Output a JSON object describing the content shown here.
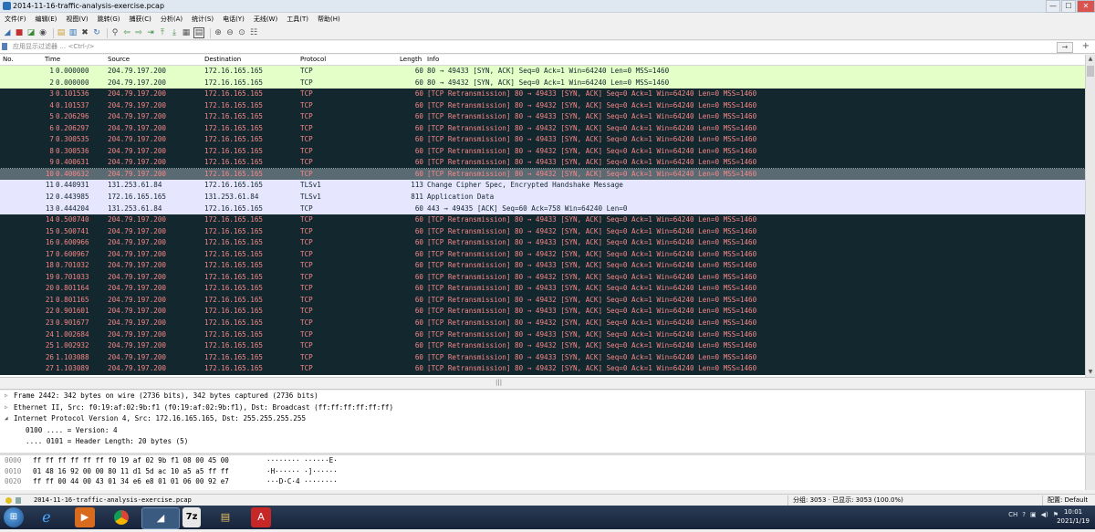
{
  "window": {
    "title": "2014-11-16-traffic-analysis-exercise.pcap",
    "buttons": {
      "minimize": "—",
      "maximize": "☐",
      "close": "✕"
    }
  },
  "menu": [
    "文件(F)",
    "编辑(E)",
    "视图(V)",
    "跳转(G)",
    "捕获(C)",
    "分析(A)",
    "统计(S)",
    "电话(Y)",
    "无线(W)",
    "工具(T)",
    "帮助(H)"
  ],
  "toolbar_icons": [
    "fin-icon",
    "stop-icon",
    "restart-icon",
    "options-icon",
    "open-icon",
    "save-icon",
    "close-file-icon",
    "reload-icon",
    "find-icon",
    "back-icon",
    "forward-icon",
    "goto-icon",
    "first-icon",
    "last-icon",
    "autoscroll-icon",
    "colorize-icon",
    "zoom-in-icon",
    "zoom-out-icon",
    "zoom-reset-icon",
    "resize-columns-icon"
  ],
  "filter": {
    "placeholder": "应用显示过滤器 … <Ctrl-/>",
    "arrow": "→",
    "plus": "+"
  },
  "columns": {
    "no": "No.",
    "time": "Time",
    "source": "Source",
    "destination": "Destination",
    "protocol": "Protocol",
    "length": "Length",
    "info": "Info"
  },
  "colors": {
    "syn_ack_bg": "#e4ffc7",
    "syn_ack_fg": "#12272e",
    "retrans_bg": "#12272e",
    "retrans_fg": "#f78787",
    "selected_bg": "#5a6a72",
    "tls_bg": "#e7e6ff",
    "tls_fg": "#12272e"
  },
  "packets": [
    {
      "no": "1",
      "time": "0.000000",
      "src": "204.79.197.200",
      "dst": "172.16.165.165",
      "proto": "TCP",
      "len": "60",
      "info": "80 → 49433 [SYN, ACK] Seq=0 Ack=1 Win=64240 Len=0 MSS=1460",
      "style": "syn"
    },
    {
      "no": "2",
      "time": "0.000000",
      "src": "204.79.197.200",
      "dst": "172.16.165.165",
      "proto": "TCP",
      "len": "60",
      "info": "80 → 49432 [SYN, ACK] Seq=0 Ack=1 Win=64240 Len=0 MSS=1460",
      "style": "syn"
    },
    {
      "no": "3",
      "time": "0.101536",
      "src": "204.79.197.200",
      "dst": "172.16.165.165",
      "proto": "TCP",
      "len": "60",
      "info": "[TCP Retransmission] 80 → 49433 [SYN, ACK] Seq=0 Ack=1 Win=64240 Len=0 MSS=1460",
      "style": "retrans"
    },
    {
      "no": "4",
      "time": "0.101537",
      "src": "204.79.197.200",
      "dst": "172.16.165.165",
      "proto": "TCP",
      "len": "60",
      "info": "[TCP Retransmission] 80 → 49432 [SYN, ACK] Seq=0 Ack=1 Win=64240 Len=0 MSS=1460",
      "style": "retrans"
    },
    {
      "no": "5",
      "time": "0.206296",
      "src": "204.79.197.200",
      "dst": "172.16.165.165",
      "proto": "TCP",
      "len": "60",
      "info": "[TCP Retransmission] 80 → 49433 [SYN, ACK] Seq=0 Ack=1 Win=64240 Len=0 MSS=1460",
      "style": "retrans"
    },
    {
      "no": "6",
      "time": "0.206297",
      "src": "204.79.197.200",
      "dst": "172.16.165.165",
      "proto": "TCP",
      "len": "60",
      "info": "[TCP Retransmission] 80 → 49432 [SYN, ACK] Seq=0 Ack=1 Win=64240 Len=0 MSS=1460",
      "style": "retrans"
    },
    {
      "no": "7",
      "time": "0.300535",
      "src": "204.79.197.200",
      "dst": "172.16.165.165",
      "proto": "TCP",
      "len": "60",
      "info": "[TCP Retransmission] 80 → 49433 [SYN, ACK] Seq=0 Ack=1 Win=64240 Len=0 MSS=1460",
      "style": "retrans"
    },
    {
      "no": "8",
      "time": "0.300536",
      "src": "204.79.197.200",
      "dst": "172.16.165.165",
      "proto": "TCP",
      "len": "60",
      "info": "[TCP Retransmission] 80 → 49432 [SYN, ACK] Seq=0 Ack=1 Win=64240 Len=0 MSS=1460",
      "style": "retrans"
    },
    {
      "no": "9",
      "time": "0.400631",
      "src": "204.79.197.200",
      "dst": "172.16.165.165",
      "proto": "TCP",
      "len": "60",
      "info": "[TCP Retransmission] 80 → 49433 [SYN, ACK] Seq=0 Ack=1 Win=64240 Len=0 MSS=1460",
      "style": "retrans"
    },
    {
      "no": "10",
      "time": "0.400632",
      "src": "204.79.197.200",
      "dst": "172.16.165.165",
      "proto": "TCP",
      "len": "60",
      "info": "[TCP Retransmission] 80 → 49432 [SYN, ACK] Seq=0 Ack=1 Win=64240 Len=0 MSS=1460",
      "style": "selected"
    },
    {
      "no": "11",
      "time": "0.440931",
      "src": "131.253.61.84",
      "dst": "172.16.165.165",
      "proto": "TLSv1",
      "len": "113",
      "info": "Change Cipher Spec, Encrypted Handshake Message",
      "style": "tls"
    },
    {
      "no": "12",
      "time": "0.443985",
      "src": "172.16.165.165",
      "dst": "131.253.61.84",
      "proto": "TLSv1",
      "len": "811",
      "info": "Application Data",
      "style": "tls"
    },
    {
      "no": "13",
      "time": "0.444204",
      "src": "131.253.61.84",
      "dst": "172.16.165.165",
      "proto": "TCP",
      "len": "60",
      "info": "443 → 49435 [ACK] Seq=60 Ack=758 Win=64240 Len=0",
      "style": "tls"
    },
    {
      "no": "14",
      "time": "0.500740",
      "src": "204.79.197.200",
      "dst": "172.16.165.165",
      "proto": "TCP",
      "len": "60",
      "info": "[TCP Retransmission] 80 → 49433 [SYN, ACK] Seq=0 Ack=1 Win=64240 Len=0 MSS=1460",
      "style": "retrans"
    },
    {
      "no": "15",
      "time": "0.500741",
      "src": "204.79.197.200",
      "dst": "172.16.165.165",
      "proto": "TCP",
      "len": "60",
      "info": "[TCP Retransmission] 80 → 49432 [SYN, ACK] Seq=0 Ack=1 Win=64240 Len=0 MSS=1460",
      "style": "retrans"
    },
    {
      "no": "16",
      "time": "0.600966",
      "src": "204.79.197.200",
      "dst": "172.16.165.165",
      "proto": "TCP",
      "len": "60",
      "info": "[TCP Retransmission] 80 → 49433 [SYN, ACK] Seq=0 Ack=1 Win=64240 Len=0 MSS=1460",
      "style": "retrans"
    },
    {
      "no": "17",
      "time": "0.600967",
      "src": "204.79.197.200",
      "dst": "172.16.165.165",
      "proto": "TCP",
      "len": "60",
      "info": "[TCP Retransmission] 80 → 49432 [SYN, ACK] Seq=0 Ack=1 Win=64240 Len=0 MSS=1460",
      "style": "retrans"
    },
    {
      "no": "18",
      "time": "0.701032",
      "src": "204.79.197.200",
      "dst": "172.16.165.165",
      "proto": "TCP",
      "len": "60",
      "info": "[TCP Retransmission] 80 → 49433 [SYN, ACK] Seq=0 Ack=1 Win=64240 Len=0 MSS=1460",
      "style": "retrans"
    },
    {
      "no": "19",
      "time": "0.701033",
      "src": "204.79.197.200",
      "dst": "172.16.165.165",
      "proto": "TCP",
      "len": "60",
      "info": "[TCP Retransmission] 80 → 49432 [SYN, ACK] Seq=0 Ack=1 Win=64240 Len=0 MSS=1460",
      "style": "retrans"
    },
    {
      "no": "20",
      "time": "0.801164",
      "src": "204.79.197.200",
      "dst": "172.16.165.165",
      "proto": "TCP",
      "len": "60",
      "info": "[TCP Retransmission] 80 → 49433 [SYN, ACK] Seq=0 Ack=1 Win=64240 Len=0 MSS=1460",
      "style": "retrans"
    },
    {
      "no": "21",
      "time": "0.801165",
      "src": "204.79.197.200",
      "dst": "172.16.165.165",
      "proto": "TCP",
      "len": "60",
      "info": "[TCP Retransmission] 80 → 49432 [SYN, ACK] Seq=0 Ack=1 Win=64240 Len=0 MSS=1460",
      "style": "retrans"
    },
    {
      "no": "22",
      "time": "0.901601",
      "src": "204.79.197.200",
      "dst": "172.16.165.165",
      "proto": "TCP",
      "len": "60",
      "info": "[TCP Retransmission] 80 → 49433 [SYN, ACK] Seq=0 Ack=1 Win=64240 Len=0 MSS=1460",
      "style": "retrans"
    },
    {
      "no": "23",
      "time": "0.901677",
      "src": "204.79.197.200",
      "dst": "172.16.165.165",
      "proto": "TCP",
      "len": "60",
      "info": "[TCP Retransmission] 80 → 49432 [SYN, ACK] Seq=0 Ack=1 Win=64240 Len=0 MSS=1460",
      "style": "retrans"
    },
    {
      "no": "24",
      "time": "1.002684",
      "src": "204.79.197.200",
      "dst": "172.16.165.165",
      "proto": "TCP",
      "len": "60",
      "info": "[TCP Retransmission] 80 → 49433 [SYN, ACK] Seq=0 Ack=1 Win=64240 Len=0 MSS=1460",
      "style": "retrans"
    },
    {
      "no": "25",
      "time": "1.002932",
      "src": "204.79.197.200",
      "dst": "172.16.165.165",
      "proto": "TCP",
      "len": "60",
      "info": "[TCP Retransmission] 80 → 49432 [SYN, ACK] Seq=0 Ack=1 Win=64240 Len=0 MSS=1460",
      "style": "retrans"
    },
    {
      "no": "26",
      "time": "1.103088",
      "src": "204.79.197.200",
      "dst": "172.16.165.165",
      "proto": "TCP",
      "len": "60",
      "info": "[TCP Retransmission] 80 → 49433 [SYN, ACK] Seq=0 Ack=1 Win=64240 Len=0 MSS=1460",
      "style": "retrans"
    },
    {
      "no": "27",
      "time": "1.103089",
      "src": "204.79.197.200",
      "dst": "172.16.165.165",
      "proto": "TCP",
      "len": "60",
      "info": "[TCP Retransmission] 80 → 49432 [SYN, ACK] Seq=0 Ack=1 Win=64240 Len=0 MSS=1460",
      "style": "retrans"
    }
  ],
  "details": [
    {
      "expander": "▷",
      "text": "Frame 2442: 342 bytes on wire (2736 bits), 342 bytes captured (2736 bits)",
      "level": 1
    },
    {
      "expander": "▷",
      "text": "Ethernet II, Src: f0:19:af:02:9b:f1 (f0:19:af:02:9b:f1), Dst: Broadcast (ff:ff:ff:ff:ff:ff)",
      "level": 1
    },
    {
      "expander": "◢",
      "text": "Internet Protocol Version 4, Src: 172.16.165.165, Dst: 255.255.255.255",
      "level": 1
    },
    {
      "expander": "",
      "text": "0100 .... = Version: 4",
      "level": 2
    },
    {
      "expander": "",
      "text": ".... 0101 = Header Length: 20 bytes (5)",
      "level": 2
    }
  ],
  "hex": [
    {
      "offset": "0000",
      "bytes": "ff ff ff ff ff ff f0 19  af 02 9b f1 08 00 45 00",
      "ascii": "········ ······E·"
    },
    {
      "offset": "0010",
      "bytes": "01 48 16 92 00 00 80 11  d1 5d ac 10 a5 a5 ff ff",
      "ascii": "·H······ ·]······"
    },
    {
      "offset": "0020",
      "bytes": "ff ff 00 44 00 43 01 34  e6 e8 01 01 06 00 92 e7",
      "ascii": "···D·C·4 ········"
    }
  ],
  "status": {
    "file": "2014-11-16-traffic-analysis-exercise.pcap",
    "stats": "分组: 3053 · 已显示: 3053 (100.0%)",
    "profile": "配置: Default"
  },
  "taskbar": {
    "apps": [
      "ie-icon",
      "media-player-icon",
      "chrome-icon",
      "wireshark-icon",
      "7zip-icon",
      "explorer-icon",
      "acrobat-icon"
    ],
    "tray": [
      "CH",
      "?"
    ],
    "time": "10:01",
    "date": "2021/1/19"
  }
}
